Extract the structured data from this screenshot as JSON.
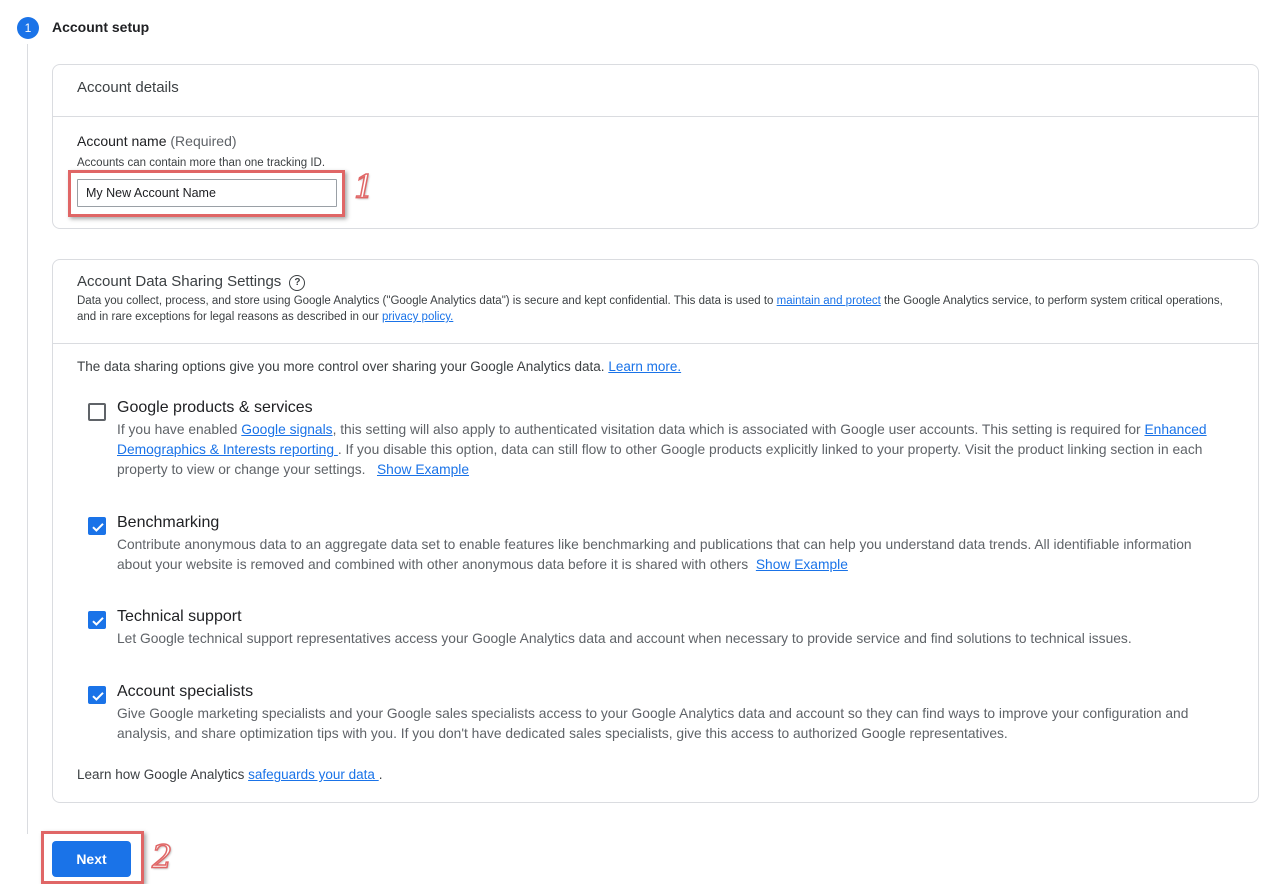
{
  "step": {
    "number": "1",
    "title": "Account setup"
  },
  "account_details": {
    "title": "Account details",
    "name_label": "Account name",
    "name_required": "(Required)",
    "hint": "Accounts can contain more than one tracking ID.",
    "input_value": "My New Account Name"
  },
  "sharing": {
    "title": "Account Data Sharing Settings",
    "desc_part1": "Data you collect, process, and store using Google Analytics (\"Google Analytics data\") is secure and kept confidential. This data is used to ",
    "desc_link1": "maintain and protect",
    "desc_part2": " the Google Analytics service, to perform system critical operations, and in rare exceptions for legal reasons as described in our ",
    "desc_link2": "privacy policy.",
    "intro": "The data sharing options give you more control over sharing your Google Analytics data. ",
    "intro_link": "Learn more.",
    "options": [
      {
        "title": "Google products & services",
        "checked": false,
        "desc_part1": "If you have enabled ",
        "desc_link1": "Google signals",
        "desc_part2": ", this setting will also apply to authenticated visitation data which is associated with Google user accounts. This setting is required for ",
        "desc_link2": "Enhanced Demographics & Interests reporting ",
        "desc_part3": ". If you disable this option, data can still flow to other Google products explicitly linked to your property. Visit the product linking section in each property to view or change your settings.",
        "example": "Show Example"
      },
      {
        "title": "Benchmarking",
        "checked": true,
        "desc": "Contribute anonymous data to an aggregate data set to enable features like benchmarking and publications that can help you understand data trends. All identifiable information about your website is removed and combined with other anonymous data before it is shared with others",
        "example": "Show Example"
      },
      {
        "title": "Technical support",
        "checked": true,
        "desc": "Let Google technical support representatives access your Google Analytics data and account when necessary to provide service and find solutions to technical issues."
      },
      {
        "title": "Account specialists",
        "checked": true,
        "desc": "Give Google marketing specialists and your Google sales specialists access to your Google Analytics data and account so they can find ways to improve your configuration and analysis, and share optimization tips with you. If you don't have dedicated sales specialists, give this access to authorized Google representatives."
      }
    ],
    "footer_text": "Learn how Google Analytics ",
    "footer_link": "safeguards your data ",
    "footer_end": "."
  },
  "next_label": "Next",
  "annotations": {
    "marker1": "1",
    "marker2": "2"
  },
  "colors": {
    "accent": "#1a73e8",
    "highlight": "#e06666"
  }
}
